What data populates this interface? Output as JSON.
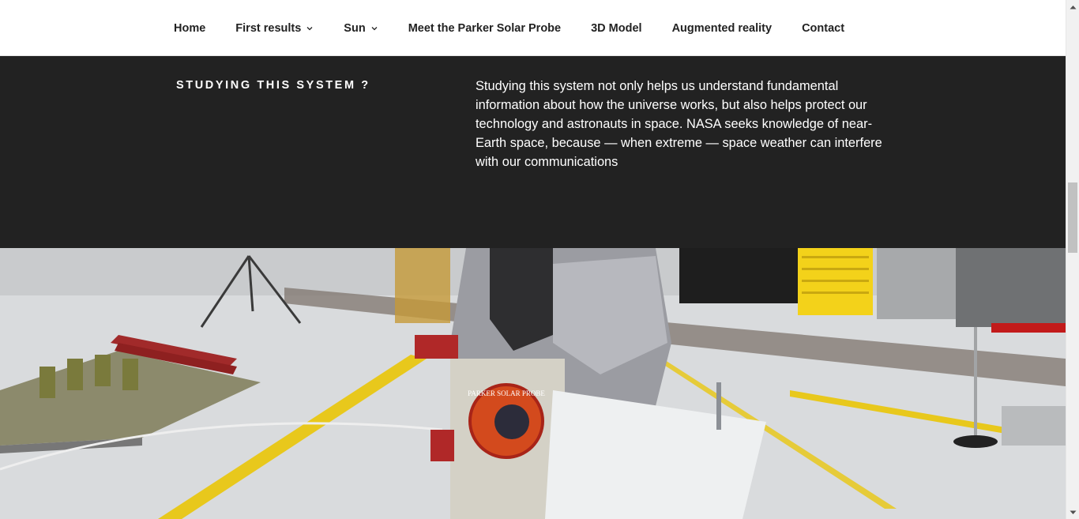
{
  "nav": {
    "items": [
      {
        "label": "Home",
        "dropdown": false
      },
      {
        "label": "First results",
        "dropdown": true
      },
      {
        "label": "Sun",
        "dropdown": true
      },
      {
        "label": "Meet the Parker Solar Probe",
        "dropdown": false
      },
      {
        "label": "3D Model",
        "dropdown": false
      },
      {
        "label": "Augmented reality",
        "dropdown": false
      },
      {
        "label": "Contact",
        "dropdown": false
      }
    ]
  },
  "section": {
    "title": "STUDYING THIS SYSTEM ?",
    "text": "Studying this system not only helps us understand fundamental information about how the universe works, but also helps protect our technology and astronauts in space. NASA seeks knowledge of near-Earth space, because — when extreme — space weather can interfere with our communications"
  },
  "photo": {
    "badge_text": "PARKER SOLAR PROBE"
  },
  "colors": {
    "nav_bg": "#ffffff",
    "section_bg": "#222222",
    "text_light": "#ffffff",
    "floor": "#d4d6d8",
    "floor_stripe": "#e8c81c"
  },
  "scrollbar": {
    "up_icon": "arrow-up-icon",
    "down_icon": "arrow-down-icon"
  }
}
